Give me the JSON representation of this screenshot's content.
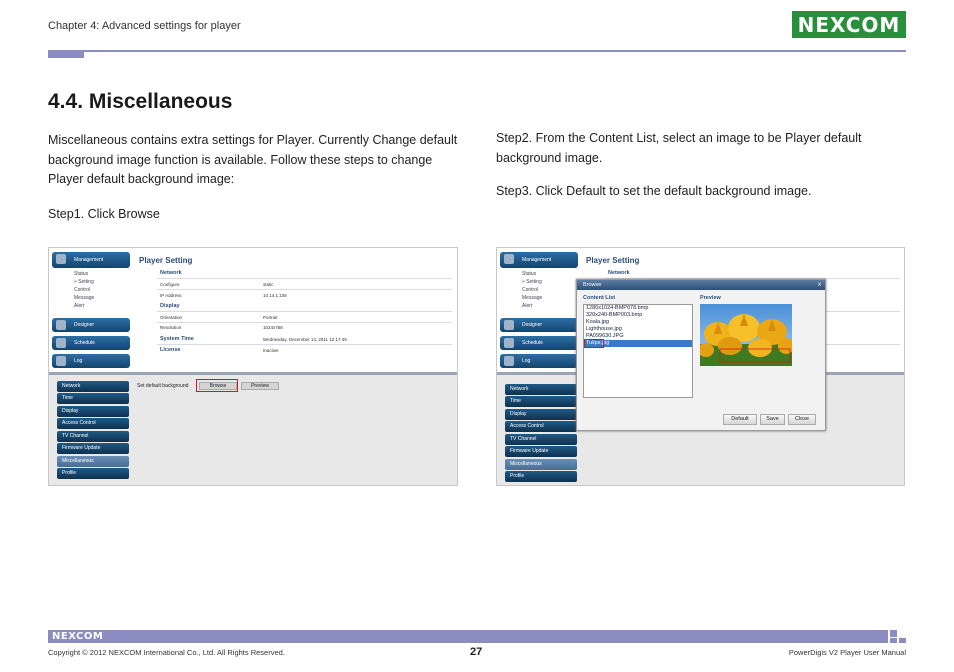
{
  "header": {
    "chapter": "Chapter 4: Advanced settings for player",
    "logo_text": "NEXCOM"
  },
  "section": {
    "title": "4.4. Miscellaneous"
  },
  "left_column": {
    "intro": "Miscellaneous contains extra settings for Player. Currently Change default background image function is available. Follow these steps to change Player default background image:",
    "step1": "Step1. Click Browse"
  },
  "right_column": {
    "step2": "Step2. From the Content List, select an image to be Player default background image.",
    "step3": "Step3. Click Default to set the default background image."
  },
  "screenshot_left": {
    "nav_management": "Management",
    "sub_items": [
      "Status",
      "» Setting",
      "Control",
      "Message",
      "Alert"
    ],
    "nav_designer": "Designer",
    "nav_schedule": "Schedule",
    "nav_log": "Log",
    "player_setting_title": "Player Setting",
    "network_head": "Network",
    "rows": [
      {
        "label": "Configure",
        "value": "static"
      },
      {
        "label": "IP Address",
        "value": "10.14.1.108"
      }
    ],
    "display_head": "Display",
    "display_rows": [
      {
        "label": "Orientation",
        "value": "Portrait"
      },
      {
        "label": "Resolution",
        "value": "1024x768"
      }
    ],
    "system_time_label": "System Time",
    "system_time_value": "Wednesday, December 14, 2011 12:17:49",
    "license_label": "License",
    "license_value": "Inactive",
    "bottom_nav": [
      "Network",
      "Time",
      "Display",
      "Access Control",
      "TV Channel",
      "Firmware Update",
      "Miscellaneous",
      "Profile"
    ],
    "set_default_label": "Set default background",
    "browse_label": "Browse",
    "preview_label": "Preview"
  },
  "screenshot_right": {
    "nav_management": "Management",
    "sub_items": [
      "Status",
      "» Setting",
      "Control",
      "Message",
      "Alert"
    ],
    "nav_designer": "Designer",
    "nav_schedule": "Schedule",
    "nav_log": "Log",
    "player_setting_title": "Player Setting",
    "network_head": "Network",
    "bottom_nav": [
      "Network",
      "Time",
      "Display",
      "Access Control",
      "TV Channel",
      "Firmware Update",
      "Miscellaneous",
      "Profile"
    ],
    "dialog": {
      "title": "Browse",
      "close": "x",
      "content_list_label": "Content List",
      "preview_label": "Preview",
      "items": [
        "1280x1024-BMP078.bmp",
        "320x240-BMP003.bmp",
        "Koala.jpg",
        "Lighthouse.jpg",
        "PA099630.JPG",
        "Tulips.jpg"
      ],
      "selected_index": 5,
      "buttons": [
        "Default",
        "Save",
        "Close"
      ]
    }
  },
  "footer": {
    "logo_text": "NEXCOM",
    "copyright": "Copyright © 2012 NEXCOM International Co., Ltd. All Rights Reserved.",
    "page_number": "27",
    "manual_name": "PowerDigis V2 Player User Manual"
  },
  "colors": {
    "accent_bar": "#8a8cc2",
    "logo_green": "#2a8f3c",
    "nav_blue": "#14446e",
    "highlight_red": "#d01a1a"
  }
}
